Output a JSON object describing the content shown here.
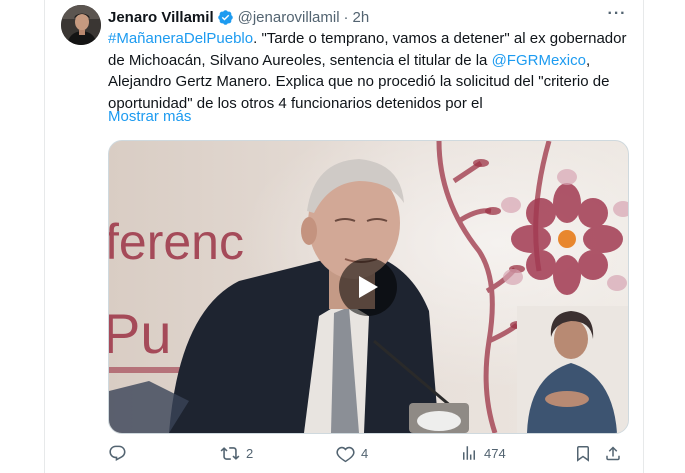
{
  "tweet": {
    "author": {
      "name": "Jenaro Villamil",
      "handle": "@jenarovillamil",
      "separator": "·",
      "time": "2h",
      "verified": true,
      "verified_color": "#1d9bf0"
    },
    "text": {
      "hashtag": "#MañaneraDelPueblo",
      "line1_rest": ". \"Tarde o temprano, vamos a detener\" al ex gobernador",
      "line2_before": "de Michoacán, Silvano Aureoles, sentencia el titular de la ",
      "mention": "@FGRMexico",
      "line2_after": ",",
      "line3": "Alejandro Gertz Manero. Explica que no procedió la solicitud del \"criterio de",
      "line4": "oportunidad\" de los otros 4 funcionarios detenidos por el"
    },
    "show_more_label": "Mostrar más",
    "media": {
      "type": "video",
      "backdrop_text": [
        "ferenc",
        "Pu"
      ]
    },
    "actions": {
      "reply": {
        "icon": "reply-icon",
        "count": ""
      },
      "retweet": {
        "icon": "retweet-icon",
        "count": "2"
      },
      "like": {
        "icon": "heart-icon",
        "count": "4"
      },
      "views": {
        "icon": "views-icon",
        "count": "474"
      },
      "bookmark": {
        "icon": "bookmark-icon"
      },
      "share": {
        "icon": "share-icon"
      }
    }
  },
  "colors": {
    "accent": "#1d9bf0",
    "muted": "#536471",
    "text": "#0f1419"
  }
}
